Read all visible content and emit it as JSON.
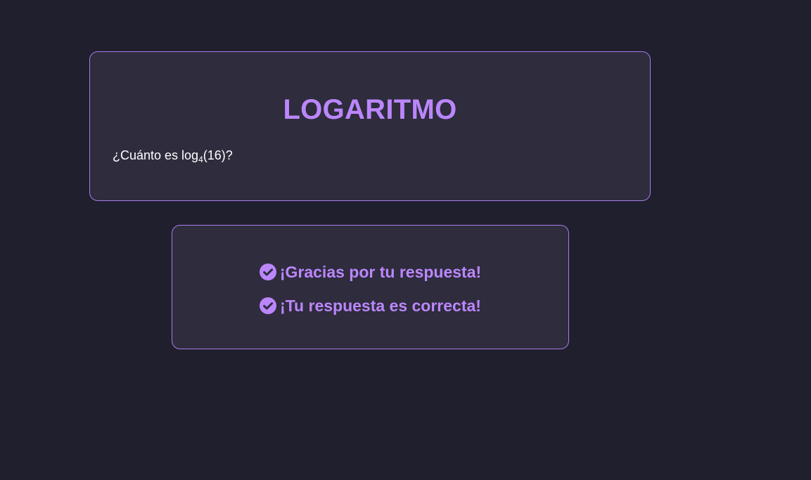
{
  "question": {
    "title": "LOGARITMO",
    "text_prefix": "¿Cuánto es log",
    "text_subscript": "4",
    "text_suffix": "(16)?"
  },
  "feedback": {
    "messages": [
      {
        "icon": "check-circle-icon",
        "text": "¡Gracias por tu respuesta!"
      },
      {
        "icon": "check-circle-icon",
        "text": "¡Tu respuesta es correcta!"
      }
    ]
  },
  "colors": {
    "background": "#201f2e",
    "card": "#2e2c3d",
    "accent": "#bb86fc",
    "border": "#a77ce8",
    "text": "#ffffff"
  }
}
